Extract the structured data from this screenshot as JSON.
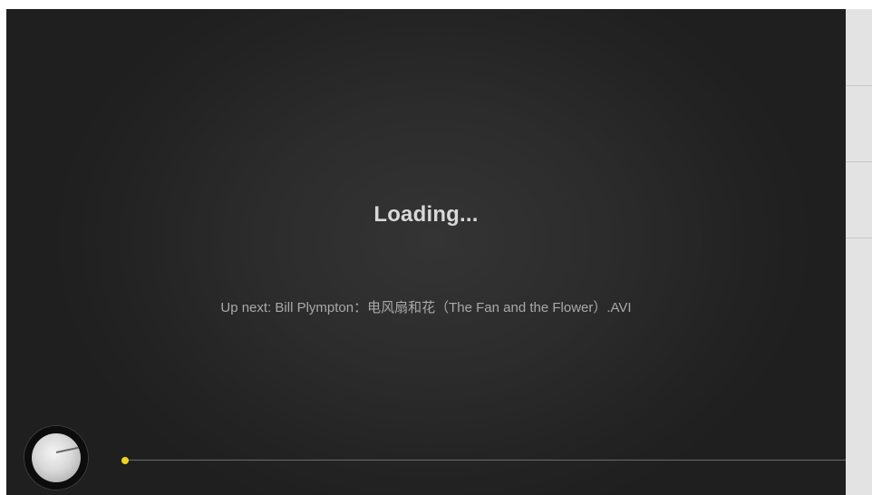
{
  "player": {
    "status_text": "Loading...",
    "up_next_prefix": "Up next:",
    "up_next_title": "Bill Plympton：电风扇和花（The Fan and the Flower）.AVI",
    "seek_progress": 0.0
  },
  "colors": {
    "background_center": "#343434",
    "background_edge": "#1f1f1f",
    "seek_handle": "#f2d21a",
    "side_panel": "#e3e3e3"
  },
  "icons": {
    "volume_knob": "knob-icon"
  }
}
